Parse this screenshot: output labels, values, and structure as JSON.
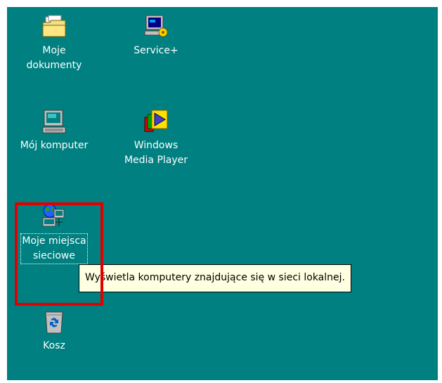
{
  "desktop": {
    "background_color": "#008080",
    "icons": [
      {
        "label": "Moje\ndokumenty",
        "icon": "folder-icon"
      },
      {
        "label": "Service+",
        "icon": "service-computer-icon"
      },
      {
        "label": "Mój komputer",
        "icon": "computer-icon"
      },
      {
        "label": "Windows\nMedia Player",
        "icon": "media-player-icon"
      },
      {
        "label": "Moje miejsca\nsieciowe",
        "icon": "network-places-icon"
      },
      {
        "label": "Kosz",
        "icon": "recycle-bin-icon"
      }
    ],
    "tooltip": {
      "text": "Wyświetla komputery znajdujące się w sieci lokalnej."
    },
    "highlight_color": "#e00000"
  }
}
